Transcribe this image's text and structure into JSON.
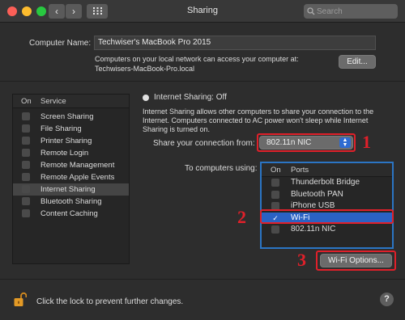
{
  "window": {
    "title": "Sharing",
    "search_placeholder": "Search",
    "nav_back": "‹",
    "nav_forward": "›",
    "grid_icon": "grid-icon"
  },
  "computer_name": {
    "label": "Computer Name:",
    "value": "Techwiser's MacBook Pro 2015",
    "info_line1": "Computers on your local network can access your computer at:",
    "info_line2": "Techwisers-MacBook-Pro.local",
    "edit_button": "Edit..."
  },
  "services": {
    "col_on": "On",
    "col_service": "Service",
    "items": [
      {
        "label": "Screen Sharing",
        "selected": false
      },
      {
        "label": "File Sharing",
        "selected": false
      },
      {
        "label": "Printer Sharing",
        "selected": false
      },
      {
        "label": "Remote Login",
        "selected": false
      },
      {
        "label": "Remote Management",
        "selected": false
      },
      {
        "label": "Remote Apple Events",
        "selected": false
      },
      {
        "label": "Internet Sharing",
        "selected": true
      },
      {
        "label": "Bluetooth Sharing",
        "selected": false
      },
      {
        "label": "Content Caching",
        "selected": false
      }
    ]
  },
  "internet_sharing": {
    "status": "Internet Sharing: Off",
    "description": "Internet Sharing allows other computers to share your connection to the Internet. Computers connected to AC power won't sleep while Internet Sharing is turned on.",
    "share_from_label": "Share your connection from:",
    "share_from_value": "802.11n NIC",
    "to_computers_label": "To computers using:",
    "ports_col_on": "On",
    "ports_col_ports": "Ports",
    "ports": [
      {
        "label": "Thunderbolt Bridge",
        "checked": false,
        "selected": false
      },
      {
        "label": "Bluetooth PAN",
        "checked": false,
        "selected": false
      },
      {
        "label": "iPhone USB",
        "checked": false,
        "selected": false
      },
      {
        "label": "Wi-Fi",
        "checked": true,
        "selected": true
      },
      {
        "label": "802.11n NIC",
        "checked": false,
        "selected": false
      }
    ],
    "wifi_options_button": "Wi-Fi Options..."
  },
  "annotations": {
    "n1": "1",
    "n2": "2",
    "n3": "3",
    "color": "#e0202a"
  },
  "footer": {
    "lock_text": "Click the lock to prevent further changes.",
    "help": "?"
  },
  "colors": {
    "window_bg": "#2d2d2d",
    "selection_blue": "#2a62c4",
    "accent_blue": "#2f6bd1",
    "red_close": "#fc5f57",
    "yellow_min": "#fdbc2e",
    "green_max": "#28c840"
  }
}
